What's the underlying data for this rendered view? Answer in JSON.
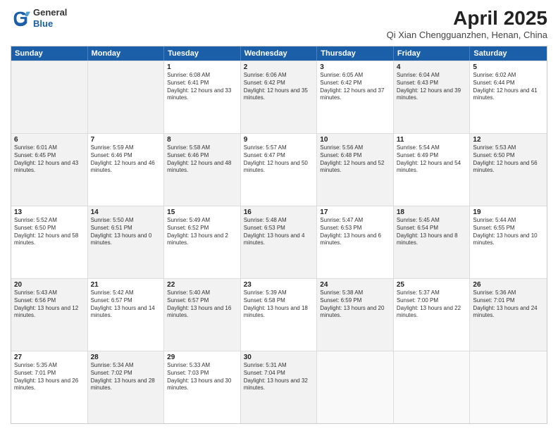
{
  "logo": {
    "general": "General",
    "blue": "Blue"
  },
  "title": "April 2025",
  "subtitle": "Qi Xian Chengguanzhen, Henan, China",
  "header_days": [
    "Sunday",
    "Monday",
    "Tuesday",
    "Wednesday",
    "Thursday",
    "Friday",
    "Saturday"
  ],
  "weeks": [
    [
      {
        "day": "",
        "sunrise": "",
        "sunset": "",
        "daylight": "",
        "alt": true
      },
      {
        "day": "",
        "sunrise": "",
        "sunset": "",
        "daylight": "",
        "alt": true
      },
      {
        "day": "1",
        "sunrise": "Sunrise: 6:08 AM",
        "sunset": "Sunset: 6:41 PM",
        "daylight": "Daylight: 12 hours and 33 minutes.",
        "alt": false
      },
      {
        "day": "2",
        "sunrise": "Sunrise: 6:06 AM",
        "sunset": "Sunset: 6:42 PM",
        "daylight": "Daylight: 12 hours and 35 minutes.",
        "alt": true
      },
      {
        "day": "3",
        "sunrise": "Sunrise: 6:05 AM",
        "sunset": "Sunset: 6:42 PM",
        "daylight": "Daylight: 12 hours and 37 minutes.",
        "alt": false
      },
      {
        "day": "4",
        "sunrise": "Sunrise: 6:04 AM",
        "sunset": "Sunset: 6:43 PM",
        "daylight": "Daylight: 12 hours and 39 minutes.",
        "alt": true
      },
      {
        "day": "5",
        "sunrise": "Sunrise: 6:02 AM",
        "sunset": "Sunset: 6:44 PM",
        "daylight": "Daylight: 12 hours and 41 minutes.",
        "alt": false
      }
    ],
    [
      {
        "day": "6",
        "sunrise": "Sunrise: 6:01 AM",
        "sunset": "Sunset: 6:45 PM",
        "daylight": "Daylight: 12 hours and 43 minutes.",
        "alt": true
      },
      {
        "day": "7",
        "sunrise": "Sunrise: 5:59 AM",
        "sunset": "Sunset: 6:46 PM",
        "daylight": "Daylight: 12 hours and 46 minutes.",
        "alt": false
      },
      {
        "day": "8",
        "sunrise": "Sunrise: 5:58 AM",
        "sunset": "Sunset: 6:46 PM",
        "daylight": "Daylight: 12 hours and 48 minutes.",
        "alt": true
      },
      {
        "day": "9",
        "sunrise": "Sunrise: 5:57 AM",
        "sunset": "Sunset: 6:47 PM",
        "daylight": "Daylight: 12 hours and 50 minutes.",
        "alt": false
      },
      {
        "day": "10",
        "sunrise": "Sunrise: 5:56 AM",
        "sunset": "Sunset: 6:48 PM",
        "daylight": "Daylight: 12 hours and 52 minutes.",
        "alt": true
      },
      {
        "day": "11",
        "sunrise": "Sunrise: 5:54 AM",
        "sunset": "Sunset: 6:49 PM",
        "daylight": "Daylight: 12 hours and 54 minutes.",
        "alt": false
      },
      {
        "day": "12",
        "sunrise": "Sunrise: 5:53 AM",
        "sunset": "Sunset: 6:50 PM",
        "daylight": "Daylight: 12 hours and 56 minutes.",
        "alt": true
      }
    ],
    [
      {
        "day": "13",
        "sunrise": "Sunrise: 5:52 AM",
        "sunset": "Sunset: 6:50 PM",
        "daylight": "Daylight: 12 hours and 58 minutes.",
        "alt": false
      },
      {
        "day": "14",
        "sunrise": "Sunrise: 5:50 AM",
        "sunset": "Sunset: 6:51 PM",
        "daylight": "Daylight: 13 hours and 0 minutes.",
        "alt": true
      },
      {
        "day": "15",
        "sunrise": "Sunrise: 5:49 AM",
        "sunset": "Sunset: 6:52 PM",
        "daylight": "Daylight: 13 hours and 2 minutes.",
        "alt": false
      },
      {
        "day": "16",
        "sunrise": "Sunrise: 5:48 AM",
        "sunset": "Sunset: 6:53 PM",
        "daylight": "Daylight: 13 hours and 4 minutes.",
        "alt": true
      },
      {
        "day": "17",
        "sunrise": "Sunrise: 5:47 AM",
        "sunset": "Sunset: 6:53 PM",
        "daylight": "Daylight: 13 hours and 6 minutes.",
        "alt": false
      },
      {
        "day": "18",
        "sunrise": "Sunrise: 5:45 AM",
        "sunset": "Sunset: 6:54 PM",
        "daylight": "Daylight: 13 hours and 8 minutes.",
        "alt": true
      },
      {
        "day": "19",
        "sunrise": "Sunrise: 5:44 AM",
        "sunset": "Sunset: 6:55 PM",
        "daylight": "Daylight: 13 hours and 10 minutes.",
        "alt": false
      }
    ],
    [
      {
        "day": "20",
        "sunrise": "Sunrise: 5:43 AM",
        "sunset": "Sunset: 6:56 PM",
        "daylight": "Daylight: 13 hours and 12 minutes.",
        "alt": true
      },
      {
        "day": "21",
        "sunrise": "Sunrise: 5:42 AM",
        "sunset": "Sunset: 6:57 PM",
        "daylight": "Daylight: 13 hours and 14 minutes.",
        "alt": false
      },
      {
        "day": "22",
        "sunrise": "Sunrise: 5:40 AM",
        "sunset": "Sunset: 6:57 PM",
        "daylight": "Daylight: 13 hours and 16 minutes.",
        "alt": true
      },
      {
        "day": "23",
        "sunrise": "Sunrise: 5:39 AM",
        "sunset": "Sunset: 6:58 PM",
        "daylight": "Daylight: 13 hours and 18 minutes.",
        "alt": false
      },
      {
        "day": "24",
        "sunrise": "Sunrise: 5:38 AM",
        "sunset": "Sunset: 6:59 PM",
        "daylight": "Daylight: 13 hours and 20 minutes.",
        "alt": true
      },
      {
        "day": "25",
        "sunrise": "Sunrise: 5:37 AM",
        "sunset": "Sunset: 7:00 PM",
        "daylight": "Daylight: 13 hours and 22 minutes.",
        "alt": false
      },
      {
        "day": "26",
        "sunrise": "Sunrise: 5:36 AM",
        "sunset": "Sunset: 7:01 PM",
        "daylight": "Daylight: 13 hours and 24 minutes.",
        "alt": true
      }
    ],
    [
      {
        "day": "27",
        "sunrise": "Sunrise: 5:35 AM",
        "sunset": "Sunset: 7:01 PM",
        "daylight": "Daylight: 13 hours and 26 minutes.",
        "alt": false
      },
      {
        "day": "28",
        "sunrise": "Sunrise: 5:34 AM",
        "sunset": "Sunset: 7:02 PM",
        "daylight": "Daylight: 13 hours and 28 minutes.",
        "alt": true
      },
      {
        "day": "29",
        "sunrise": "Sunrise: 5:33 AM",
        "sunset": "Sunset: 7:03 PM",
        "daylight": "Daylight: 13 hours and 30 minutes.",
        "alt": false
      },
      {
        "day": "30",
        "sunrise": "Sunrise: 5:31 AM",
        "sunset": "Sunset: 7:04 PM",
        "daylight": "Daylight: 13 hours and 32 minutes.",
        "alt": true
      },
      {
        "day": "",
        "sunrise": "",
        "sunset": "",
        "daylight": "",
        "alt": false
      },
      {
        "day": "",
        "sunrise": "",
        "sunset": "",
        "daylight": "",
        "alt": false
      },
      {
        "day": "",
        "sunrise": "",
        "sunset": "",
        "daylight": "",
        "alt": false
      }
    ]
  ]
}
